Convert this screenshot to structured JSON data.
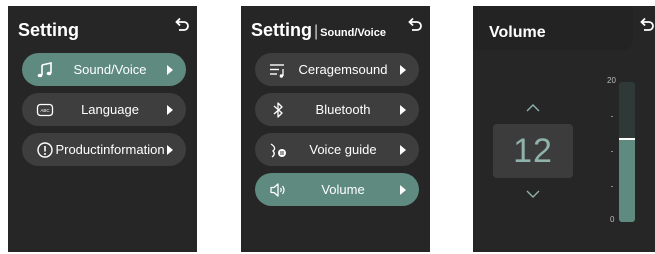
{
  "screens": [
    {
      "title": "Setting",
      "items": [
        {
          "label": "Sound/Voice",
          "icon": "music-note-icon",
          "active": true
        },
        {
          "label": "Language",
          "icon": "abc-keyboard-icon",
          "active": false
        },
        {
          "label": "Product information",
          "label_lines": [
            "Product",
            "information"
          ],
          "icon": "info-icon",
          "active": false
        }
      ]
    },
    {
      "title": "Setting",
      "separator": "|",
      "subtitle": "Sound/Voice",
      "items": [
        {
          "label_lines": [
            "Ceragem",
            "sound"
          ],
          "icon": "sound-list-icon",
          "active": false
        },
        {
          "label": "Bluetooth",
          "icon": "bluetooth-icon",
          "active": false
        },
        {
          "label": "Voice guide",
          "icon": "voice-guide-icon",
          "active": false
        },
        {
          "label": "Volume",
          "icon": "speaker-icon",
          "active": true
        }
      ]
    },
    {
      "title": "Volume",
      "value": "12",
      "scale_max": "20",
      "scale_min": "0",
      "level_fraction": 0.6
    }
  ],
  "colors": {
    "screen_bg": "#262626",
    "item_bg": "#3e3e3e",
    "accent": "#5e8a80",
    "value_text": "#8fb2aa"
  }
}
